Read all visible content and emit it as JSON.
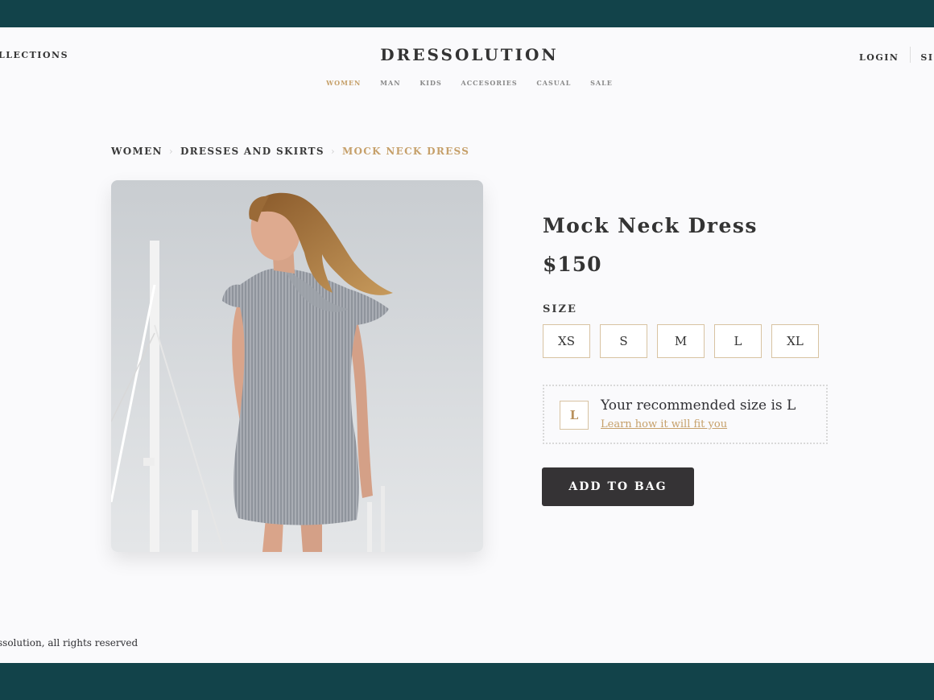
{
  "header": {
    "left_link": "LLECTIONS",
    "brand": "DRESSOLUTION",
    "login": "LOGIN",
    "signup": "SIG"
  },
  "categories": [
    "WOMEN",
    "MAN",
    "KIDS",
    "ACCESORIES",
    "CASUAL",
    "SALE"
  ],
  "active_category": "WOMEN",
  "breadcrumb": {
    "items": [
      "WOMEN",
      "DRESSES AND SKIRTS",
      "MOCK NECK DRESS"
    ],
    "separator": "›"
  },
  "product": {
    "title": "Mock Neck Dress",
    "price": "$150",
    "size_label": "SIZE",
    "sizes": [
      "XS",
      "S",
      "M",
      "L",
      "XL"
    ],
    "recommendation": {
      "badge": "L",
      "text": "Your recommended size is L",
      "link": "Learn how it will fit you"
    },
    "add_to_bag": "ADD TO BAG"
  },
  "footer": {
    "text": "ssolution, all rights reserved"
  },
  "colors": {
    "frame": "#12434a",
    "accent": "#c6a06a",
    "button": "#353335",
    "background": "#fafafc"
  }
}
